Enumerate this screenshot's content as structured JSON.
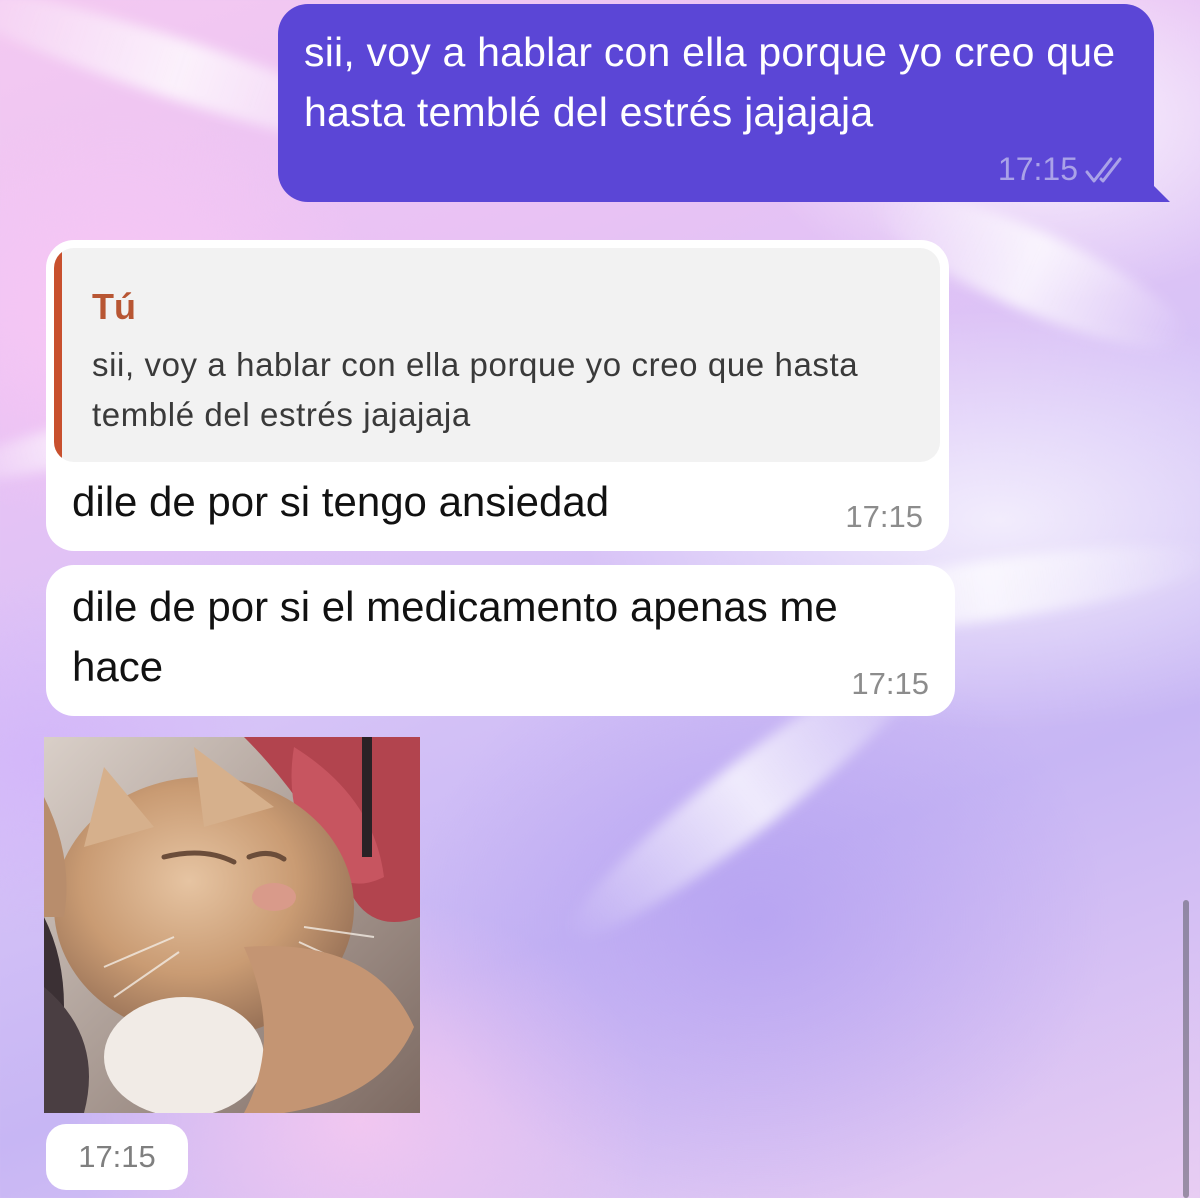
{
  "colors": {
    "outgoing_bubble": "#5b46d6",
    "incoming_bubble": "#ffffff",
    "reply_accent": "#c8502e"
  },
  "messages": {
    "outgoing": {
      "text": "sii, voy a hablar con ella porque yo creo que hasta temblé del estrés jajajaja",
      "time": "17:15",
      "status_icon": "double-check-icon"
    },
    "incoming_reply": {
      "quoted_author": "Tú",
      "quoted_text": "sii, voy a hablar con ella porque yo creo que hasta temblé del estrés jajajaja",
      "text": "dile de por si tengo ansiedad",
      "time": "17:15"
    },
    "incoming_second": {
      "text": "dile de por si el medicamento apenas me hace",
      "time": "17:15"
    },
    "incoming_gif": {
      "media": "cat-gif",
      "time": "17:15"
    }
  }
}
